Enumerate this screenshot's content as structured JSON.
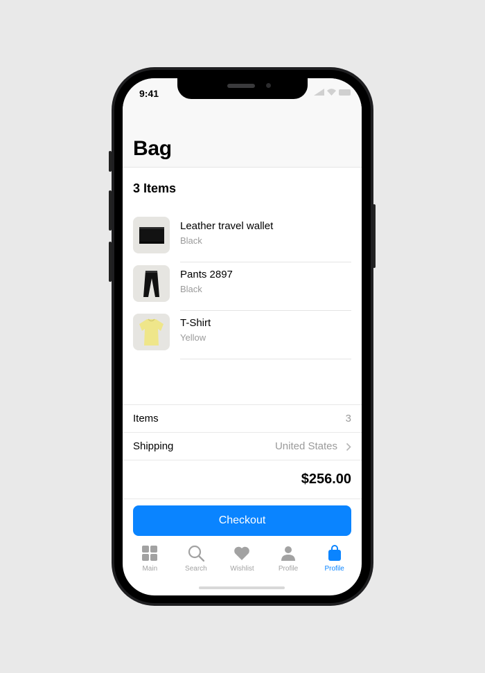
{
  "status_bar": {
    "time": "9:41"
  },
  "header": {
    "title": "Bag"
  },
  "bag": {
    "count_label": "3 Items",
    "products": [
      {
        "name": "Leather travel wallet",
        "variant": "Black",
        "icon": "wallet-image"
      },
      {
        "name": "Pants 2897",
        "variant": "Black",
        "icon": "pants-image"
      },
      {
        "name": "T-Shirt",
        "variant": "Yellow",
        "icon": "tshirt-image"
      }
    ]
  },
  "summary": {
    "items_label": "Items",
    "items_value": "3",
    "shipping_label": "Shipping",
    "shipping_value": "United States",
    "total": "$256.00"
  },
  "checkout_label": "Checkout",
  "tabs": [
    {
      "label": "Main",
      "icon": "grid-icon",
      "active": false
    },
    {
      "label": "Search",
      "icon": "search-icon",
      "active": false
    },
    {
      "label": "Wishlist",
      "icon": "heart-icon",
      "active": false
    },
    {
      "label": "Profile",
      "icon": "person-icon",
      "active": false
    },
    {
      "label": "Profile",
      "icon": "bag-icon",
      "active": true
    }
  ],
  "colors": {
    "accent": "#0a84ff",
    "inactive": "#a2a2a2",
    "background": "#e9e9e9"
  }
}
